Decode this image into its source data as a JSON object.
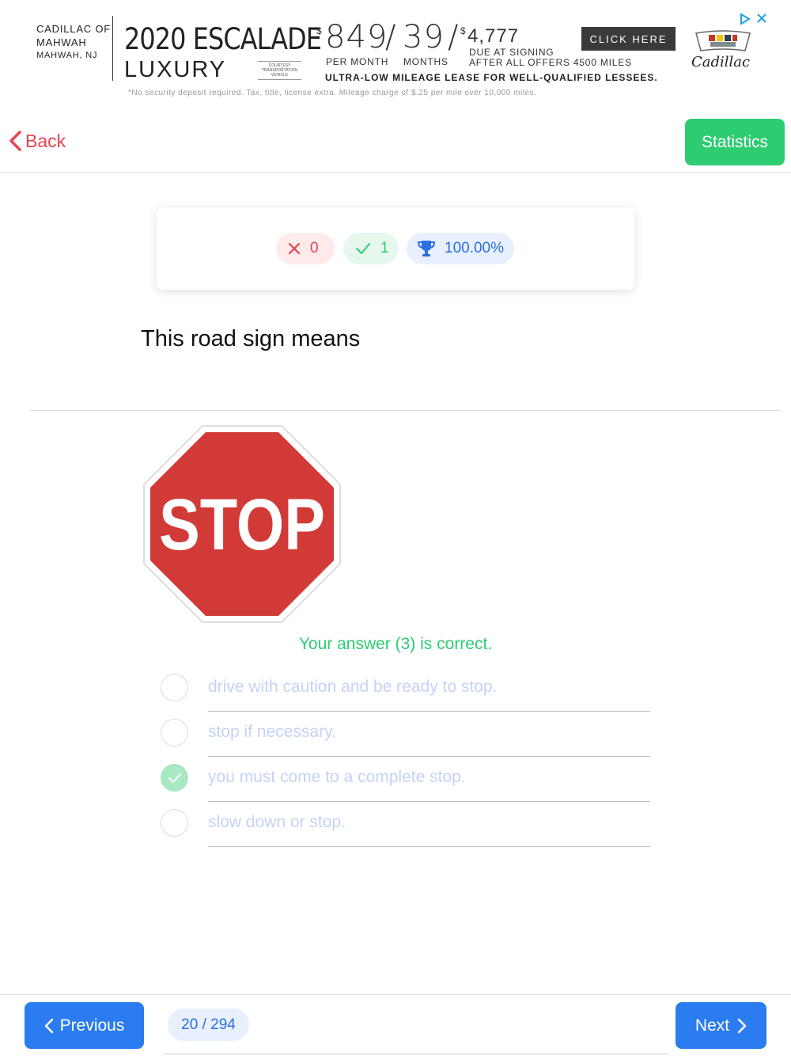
{
  "ad": {
    "dealer_line1": "CADILLAC OF",
    "dealer_line2": "MAHWAH",
    "dealer_city": "MAHWAH, NJ",
    "model": "2020 ESCALADE",
    "trim": "LUXURY",
    "courtesy": "COURTESY TRANSPORTATION VEHICLE",
    "currency_symbol": "$",
    "price": "849",
    "months": "39",
    "separator": "/",
    "due": "4,777",
    "per_month_label": "PER MONTH",
    "months_label": "MONTHS",
    "due_label_1": "DUE AT SIGNING",
    "due_label_2": "AFTER ALL OFFERS 4500 MILES",
    "headline": "ULTRA-LOW MILEAGE LEASE FOR WELL-QUALIFIED LESSEES.",
    "fine_print": "*No security deposit required.  Tax, title, license extra.  Mileage charge of $.25 per mile over 10,000 miles.",
    "cta": "CLICK HERE",
    "brand": "Cadillac"
  },
  "nav": {
    "back_label": "Back",
    "statistics_label": "Statistics"
  },
  "score": {
    "wrong": "0",
    "correct": "1",
    "percent": "100.00%"
  },
  "question": {
    "text": "This road sign means",
    "sign_text": "STOP",
    "feedback": "Your answer (3) is correct.",
    "options": [
      {
        "label": "drive with caution and be ready to stop.",
        "selected": false
      },
      {
        "label": "stop if necessary.",
        "selected": false
      },
      {
        "label": "you must come to a complete stop.",
        "selected": true
      },
      {
        "label": "slow down or stop.",
        "selected": false
      }
    ]
  },
  "footer": {
    "previous_label": "Previous",
    "next_label": "Next",
    "counter": "20 / 294"
  },
  "colors": {
    "green": "#2ecc71",
    "blue": "#2b7cf0",
    "red": "#e8434f",
    "stop_red": "#d13a36"
  }
}
